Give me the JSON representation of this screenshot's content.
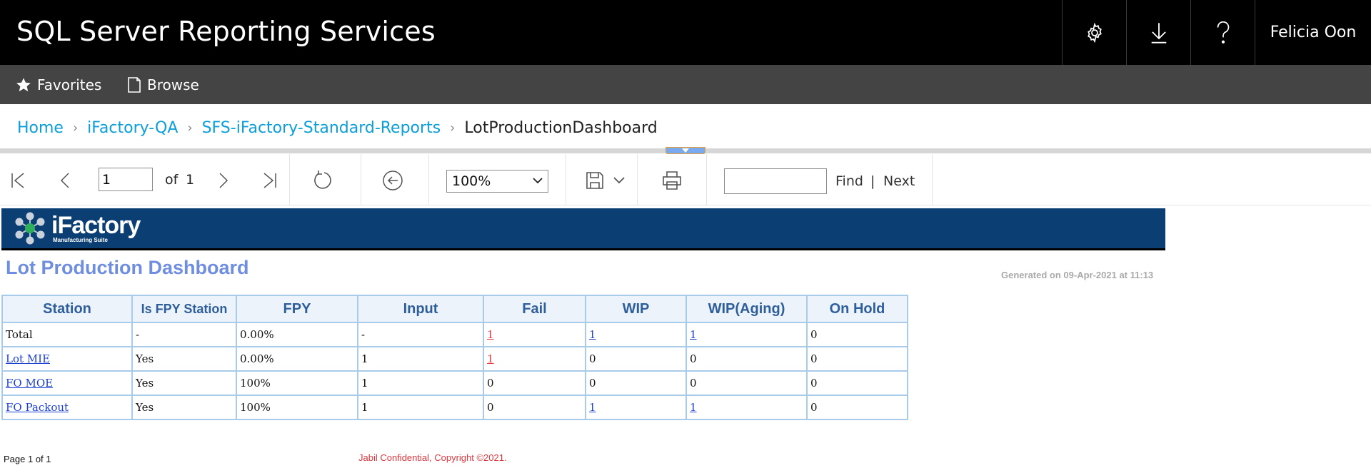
{
  "header": {
    "app_title": "SQL Server Reporting Services",
    "user_name": "Felicia Oon",
    "icons": [
      "gear-icon",
      "download-icon",
      "help-icon"
    ]
  },
  "nav": {
    "favorites_label": "Favorites",
    "browse_label": "Browse"
  },
  "breadcrumb": {
    "items": [
      "Home",
      "iFactory-QA",
      "SFS-iFactory-Standard-Reports"
    ],
    "current": "LotProductionDashboard"
  },
  "toolbar": {
    "page_value": "1",
    "of_label": "of",
    "total_pages": "1",
    "zoom": "100%",
    "find_label": "Find",
    "find_separator": "|",
    "next_label": "Next"
  },
  "report": {
    "logo_name": "iFactory",
    "logo_sub": "Manufacturing Suite",
    "title": "Lot Production Dashboard",
    "generated": "Generated on 09-Apr-2021 at 11:13",
    "columns": [
      "Station",
      "Is FPY Station",
      "FPY",
      "Input",
      "Fail",
      "WIP",
      "WIP(Aging)",
      "On Hold"
    ],
    "rows": [
      {
        "station": "Total",
        "is_fpy": "-",
        "fpy": "0.00%",
        "input": "-",
        "fail": "1",
        "wip": "1",
        "wip_aging": "1",
        "on_hold": "0"
      },
      {
        "station": "Lot MIE",
        "is_fpy": "Yes",
        "fpy": "0.00%",
        "input": "1",
        "fail": "1",
        "wip": "0",
        "wip_aging": "0",
        "on_hold": "0"
      },
      {
        "station": "FO MOE",
        "is_fpy": "Yes",
        "fpy": "100%",
        "input": "1",
        "fail": "0",
        "wip": "0",
        "wip_aging": "0",
        "on_hold": "0"
      },
      {
        "station": "FO Packout",
        "is_fpy": "Yes",
        "fpy": "100%",
        "input": "1",
        "fail": "0",
        "wip": "1",
        "wip_aging": "1",
        "on_hold": "0"
      }
    ],
    "page_footer": "Page 1 of 1",
    "copyright": "Jabil Confidential, Copyright ©2021."
  },
  "colors": {
    "header_bg": "#000000",
    "nav_bg": "#444444",
    "link": "#0b9ed8",
    "banner": "#0b3f74",
    "title": "#6f8ee0",
    "fail_link": "#e0363e",
    "wip_link": "#1b3fcf"
  }
}
